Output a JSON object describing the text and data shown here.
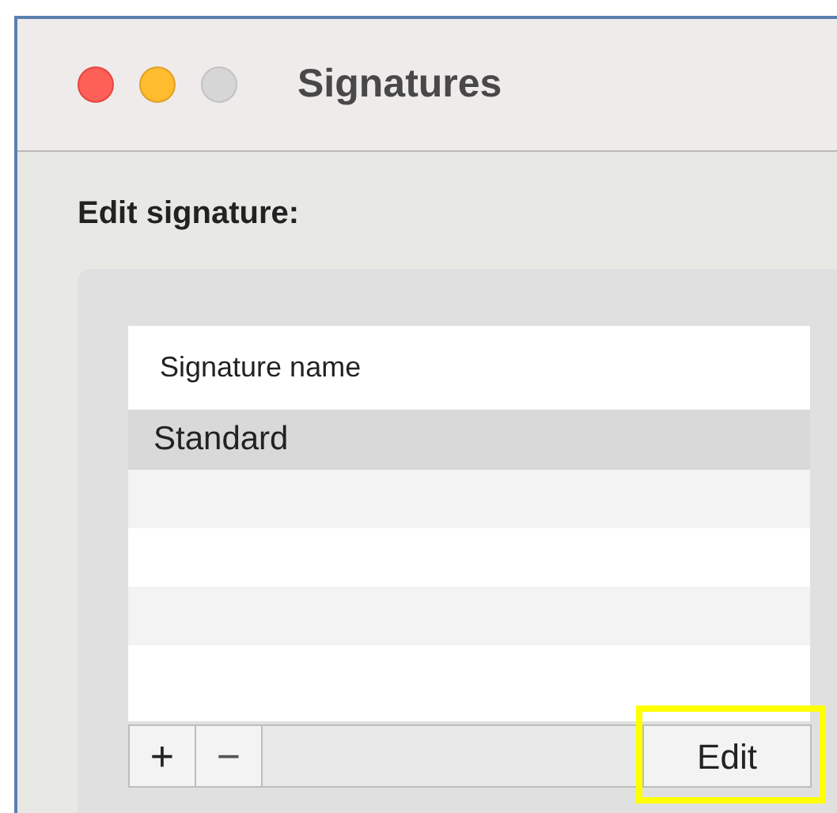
{
  "window": {
    "title": "Signatures",
    "buttons": [
      {
        "kind": "close"
      },
      {
        "kind": "minimize"
      },
      {
        "kind": "zoom"
      }
    ]
  },
  "heading": "Edit signature:",
  "table": {
    "columns": [
      "Signature name"
    ],
    "rows": [
      {
        "name": "Standard",
        "selected": true
      }
    ]
  },
  "controls": {
    "add": "+",
    "remove": "−"
  },
  "edit_button": {
    "label": "Edit",
    "highlighted": true
  }
}
